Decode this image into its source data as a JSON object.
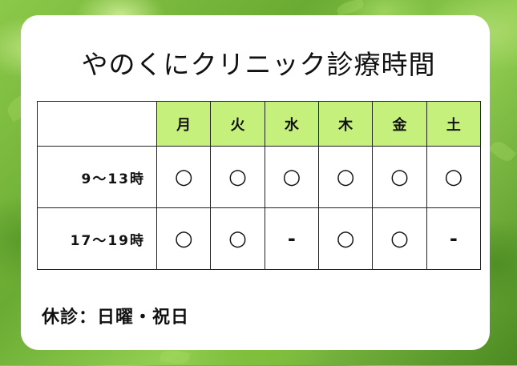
{
  "title": "やのくにクリニック診療時間",
  "days": [
    "月",
    "火",
    "水",
    "木",
    "金",
    "土"
  ],
  "rows": [
    {
      "time": "9～13時",
      "marks": [
        "○",
        "○",
        "○",
        "○",
        "○",
        "○"
      ]
    },
    {
      "time": "17～19時",
      "marks": [
        "○",
        "○",
        "-",
        "○",
        "○",
        "-"
      ]
    }
  ],
  "closed_days": "休診：日曜・祝日",
  "colors": {
    "header_bg": "#c6f07c",
    "card_bg": "#ffffff",
    "background": "#7fbf3a"
  }
}
